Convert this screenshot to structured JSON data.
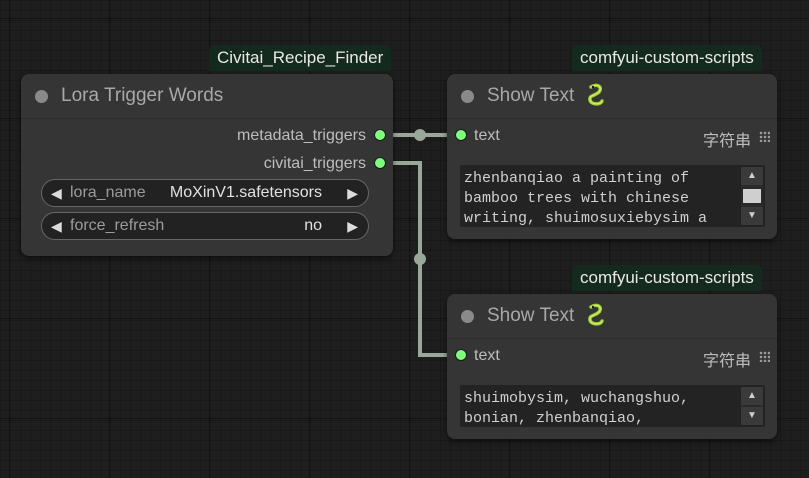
{
  "canvas": {
    "background": "#1e1e1e",
    "link_color": "#9aa89a",
    "slot_color": "#7dff7d"
  },
  "nodes": {
    "lora": {
      "badge": "Civitai_Recipe_Finder",
      "title": "Lora Trigger Words",
      "outputs": [
        {
          "label": "metadata_triggers"
        },
        {
          "label": "civitai_triggers"
        }
      ],
      "widgets": [
        {
          "name": "lora_name",
          "value": "MoXinV1.safetensors"
        },
        {
          "name": "force_refresh",
          "value": "no"
        }
      ]
    },
    "show1": {
      "badge": "comfyui-custom-scripts",
      "title": "Show Text",
      "icon": "snake-icon",
      "input_label": "text",
      "type_label": "字符串",
      "text": "zhenbanqiao a painting of bamboo trees with chinese writing, shuimosuxiebysim a"
    },
    "show2": {
      "badge": "comfyui-custom-scripts",
      "title": "Show Text",
      "icon": "snake-icon",
      "input_label": "text",
      "type_label": "字符串",
      "text": "shuimobysim, wuchangshuo, bonian, zhenbanqiao,"
    }
  }
}
